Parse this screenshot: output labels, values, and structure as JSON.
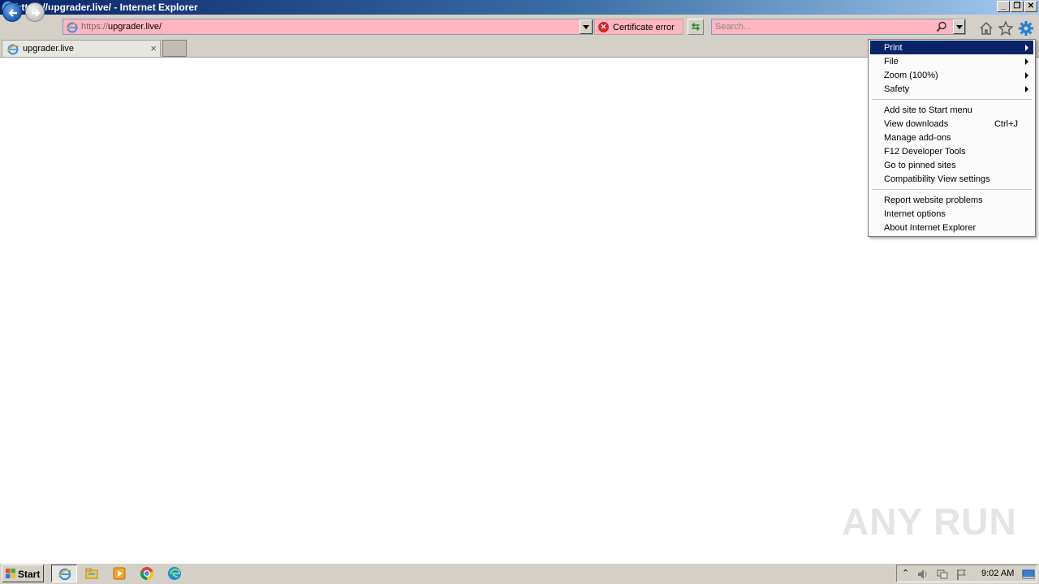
{
  "window": {
    "title": "https://upgrader.live/ - Internet Explorer",
    "minimize": "_",
    "restore": "❐",
    "close": "✕"
  },
  "navbar": {
    "address_prefix": "https://",
    "address_host": "upgrader.live/",
    "cert_error": "Certificate error",
    "search_placeholder": "Search..."
  },
  "tabs": [
    {
      "label": "upgrader.live",
      "close": "×"
    }
  ],
  "menu": {
    "items": [
      {
        "label": "Print",
        "submenu": true,
        "highlighted": true
      },
      {
        "label": "File",
        "submenu": true
      },
      {
        "label": "Zoom (100%)",
        "submenu": true
      },
      {
        "label": "Safety",
        "submenu": true
      },
      {
        "label": "Add site to Start menu"
      },
      {
        "label": "View downloads",
        "shortcut": "Ctrl+J"
      },
      {
        "label": "Manage add-ons"
      },
      {
        "label": "F12 Developer Tools"
      },
      {
        "label": "Go to pinned sites"
      },
      {
        "label": "Compatibility View settings"
      },
      {
        "label": "Report website problems"
      },
      {
        "label": "Internet options"
      },
      {
        "label": "About Internet Explorer"
      }
    ]
  },
  "watermark": {
    "text": "ANY RUN"
  },
  "taskbar": {
    "start_label": "Start",
    "apps": [
      "internet-explorer-icon",
      "file-explorer-icon",
      "media-player-icon",
      "chrome-icon",
      "edge-icon"
    ],
    "clock": "9:02 AM"
  },
  "colors": {
    "chrome": "#d4d0c8",
    "error_pink": "#ffb6c1",
    "menu_highlight": "#0a246a"
  }
}
